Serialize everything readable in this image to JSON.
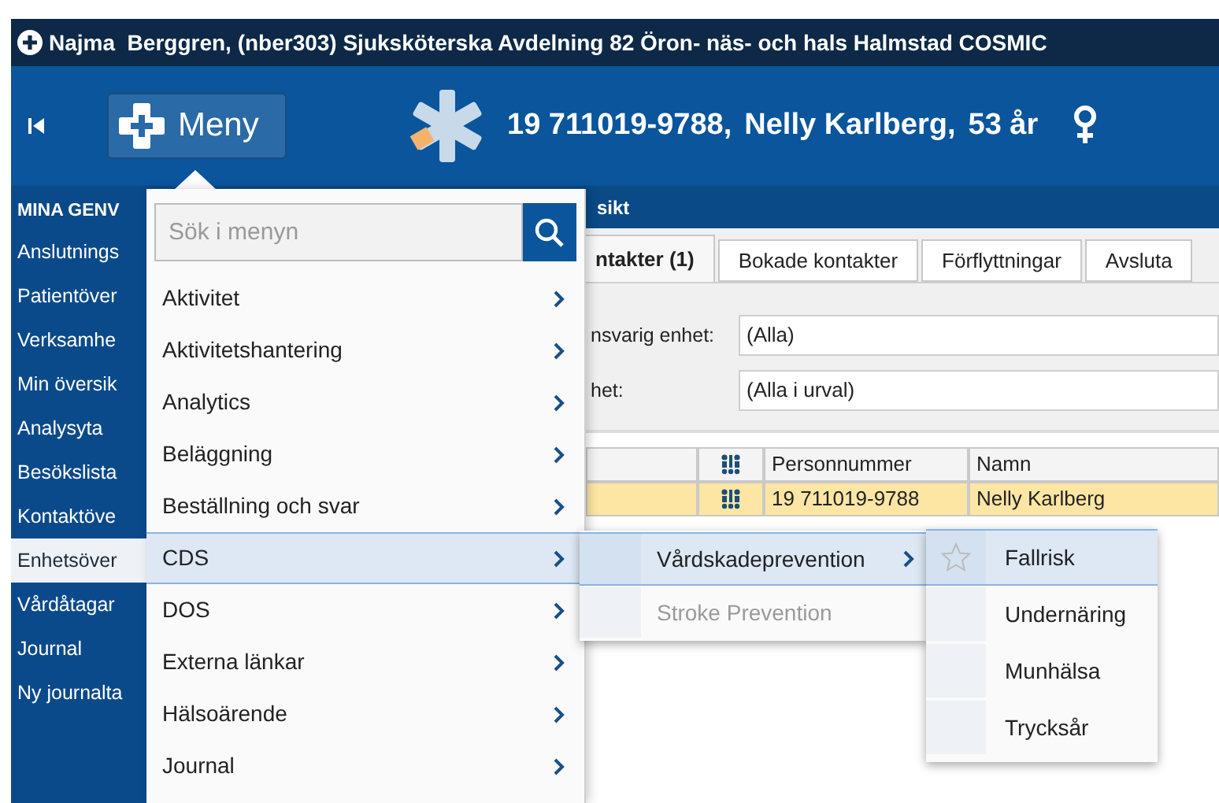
{
  "title_bar": {
    "text": "Najma  Berggren, (nber303) Sjuksköterska Avdelning 82 Öron- näs- och hals Halmstad COSMIC"
  },
  "header": {
    "menu_button": "Meny",
    "personnummer": "19 711019-9788,",
    "name": "Nelly Karlberg,",
    "age": "53 år"
  },
  "sidebar": {
    "heading": "MINA GENV",
    "items": [
      {
        "label": "Anslutnings",
        "selected": false
      },
      {
        "label": "Patientöver",
        "selected": false
      },
      {
        "label": "Verksamhe",
        "selected": false
      },
      {
        "label": "Min översik",
        "selected": false
      },
      {
        "label": "Analysyta",
        "selected": false
      },
      {
        "label": "Besökslista",
        "selected": false
      },
      {
        "label": "Kontaktöve",
        "selected": false
      },
      {
        "label": "Enhetsöver",
        "selected": true
      },
      {
        "label": "Vårdåtagar",
        "selected": false
      },
      {
        "label": "Journal",
        "selected": false
      },
      {
        "label": "Ny journalta",
        "selected": false
      }
    ]
  },
  "content": {
    "panel_title": "sikt",
    "tabs": [
      {
        "label": "ntakter (1)",
        "selected": true
      },
      {
        "label": "Bokade kontakter",
        "selected": false
      },
      {
        "label": "Förflyttningar",
        "selected": false
      },
      {
        "label": "Avsluta",
        "selected": false
      }
    ],
    "filters": [
      {
        "label": "nsvarig enhet:",
        "value": "(Alla)"
      },
      {
        "label": "het:",
        "value": "(Alla i urval)"
      }
    ],
    "table": {
      "columns": [
        {
          "kind": "empty"
        },
        {
          "kind": "icon"
        },
        {
          "kind": "text",
          "label": "Personnummer"
        },
        {
          "kind": "text",
          "label": "Namn"
        }
      ],
      "rows": [
        {
          "selected": true,
          "cells": [
            {
              "kind": "empty"
            },
            {
              "kind": "icon"
            },
            {
              "kind": "text",
              "text": "19 711019-9788"
            },
            {
              "kind": "text",
              "text": "Nelly Karlberg"
            }
          ]
        }
      ]
    }
  },
  "menu": {
    "search": {
      "placeholder": "Sök i menyn"
    },
    "items": [
      {
        "label": "Aktivitet",
        "selected": false
      },
      {
        "label": "Aktivitetshantering",
        "selected": false
      },
      {
        "label": "Analytics",
        "selected": false
      },
      {
        "label": "Beläggning",
        "selected": false
      },
      {
        "label": "Beställning och svar",
        "selected": false
      },
      {
        "label": "CDS",
        "selected": true
      },
      {
        "label": "DOS",
        "selected": false
      },
      {
        "label": "Externa länkar",
        "selected": false
      },
      {
        "label": "Hälsoärende",
        "selected": false
      },
      {
        "label": "Journal",
        "selected": false
      }
    ]
  },
  "submenu": {
    "items": [
      {
        "label": "Vårdskadeprevention",
        "selected": true,
        "disabled": false,
        "has_children": true
      },
      {
        "label": "Stroke Prevention",
        "selected": false,
        "disabled": true,
        "has_children": false
      }
    ]
  },
  "submenu_2": {
    "items": [
      {
        "label": "Fallrisk",
        "selected": true
      },
      {
        "label": "Undernäring",
        "selected": false
      },
      {
        "label": "Munhälsa",
        "selected": false
      },
      {
        "label": "Trycksår",
        "selected": false
      }
    ]
  }
}
